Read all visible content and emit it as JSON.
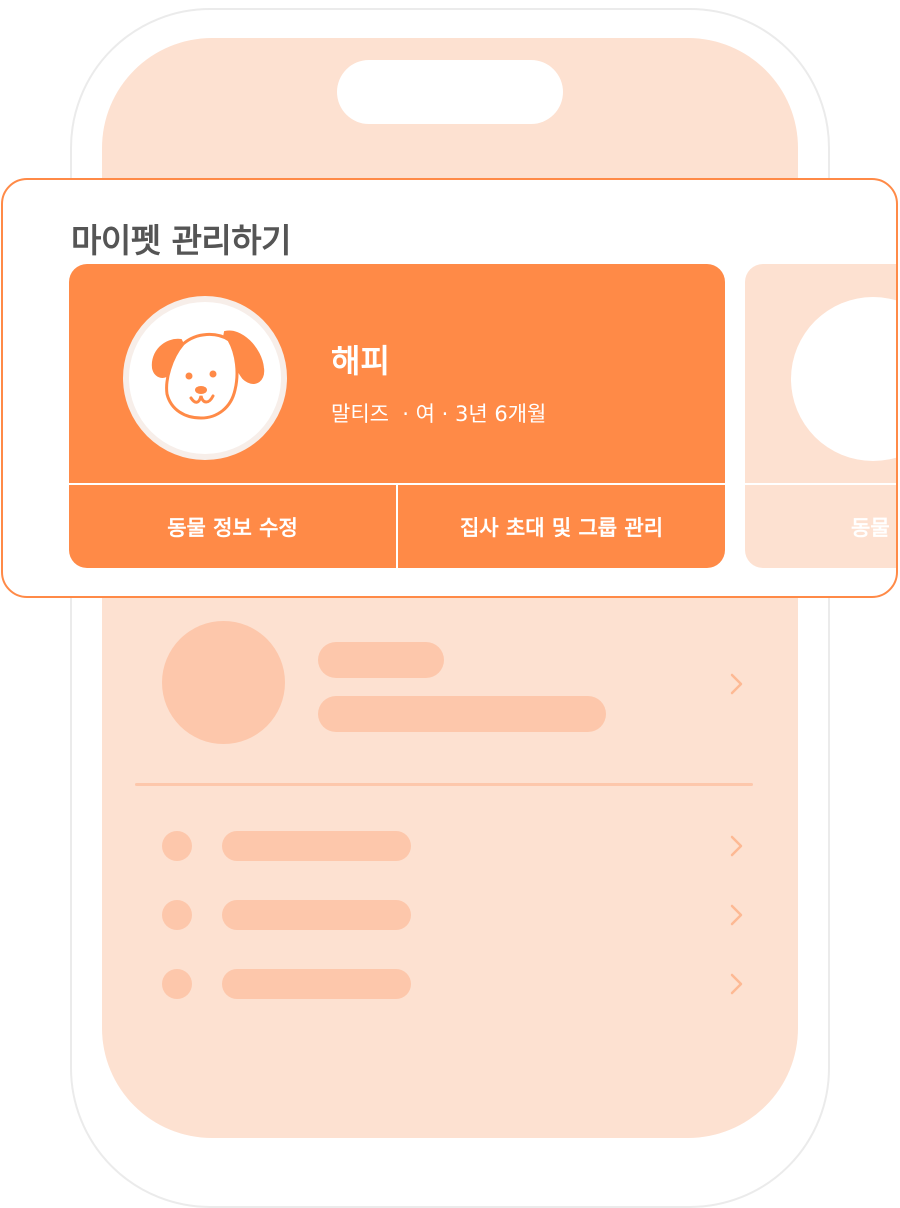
{
  "panel": {
    "title": "마이펫 관리하기"
  },
  "pet_card": {
    "name": "해피",
    "meta": "말티즈  · 여 · 3년 6개월",
    "edit_label": "동물 정보 수정",
    "invite_label": "집사 초대 및 그룹 관리"
  },
  "next_card": {
    "edit_label_partial": "동물"
  },
  "icons": {
    "avatar": "dog-face-icon",
    "chevron": "chevron-right-icon"
  },
  "colors": {
    "accent": "#ff8a47",
    "screen_bg": "#fde1d1",
    "skeleton": "#fdc7ab"
  }
}
